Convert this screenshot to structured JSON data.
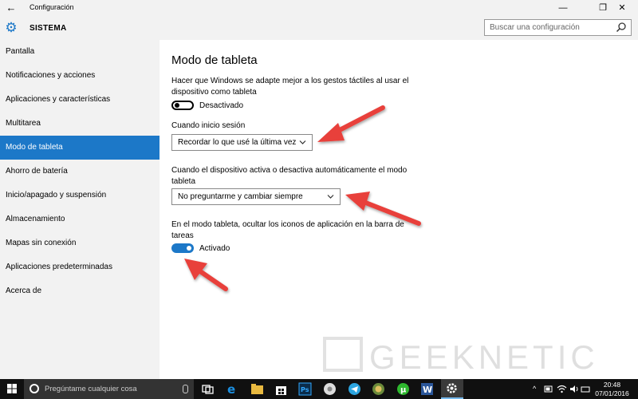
{
  "window": {
    "title": "Configuración",
    "back_glyph": "←",
    "minimize_glyph": "—",
    "maximize_glyph": "❐",
    "close_glyph": "✕"
  },
  "header": {
    "section_title": "SISTEMA",
    "search_placeholder": "Buscar una configuración"
  },
  "sidebar": {
    "items": [
      {
        "label": "Pantalla"
      },
      {
        "label": "Notificaciones y acciones"
      },
      {
        "label": "Aplicaciones y características"
      },
      {
        "label": "Multitarea"
      },
      {
        "label": "Modo de tableta",
        "active": true
      },
      {
        "label": "Ahorro de batería"
      },
      {
        "label": "Inicio/apagado y suspensión"
      },
      {
        "label": "Almacenamiento"
      },
      {
        "label": "Mapas sin conexión"
      },
      {
        "label": "Aplicaciones predeterminadas"
      },
      {
        "label": "Acerca de"
      }
    ]
  },
  "main": {
    "title": "Modo de tableta",
    "setting1": {
      "description": "Hacer que Windows se adapte mejor a los gestos táctiles al usar el dispositivo como tableta",
      "toggle_state": "off",
      "toggle_label": "Desactivado"
    },
    "setting2": {
      "label": "Cuando inicio sesión",
      "value": "Recordar lo que usé la última vez"
    },
    "setting3": {
      "label": "Cuando el dispositivo activa o desactiva automáticamente el modo tableta",
      "value": "No preguntarme y cambiar siempre"
    },
    "setting4": {
      "description": "En el modo tableta, ocultar los iconos de aplicación en la barra de tareas",
      "toggle_state": "on",
      "toggle_label": "Activado"
    }
  },
  "watermark": {
    "text": "GEEKNETIC"
  },
  "taskbar": {
    "search_placeholder": "Pregúntame cualquier cosa",
    "icons": [
      "task-view-icon",
      "edge-icon",
      "file-explorer-icon",
      "store-icon",
      "photoshop-icon",
      "chrome-icon",
      "telegram-icon",
      "browser-icon",
      "utorrent-icon",
      "word-icon",
      "settings-icon"
    ],
    "time": "20:48",
    "date": "07/01/2016"
  },
  "colors": {
    "accent": "#1c78c8",
    "sidebar_bg": "#f2f2f2",
    "annotation_arrow": "#e8403a",
    "taskbar_bg": "#101010"
  }
}
